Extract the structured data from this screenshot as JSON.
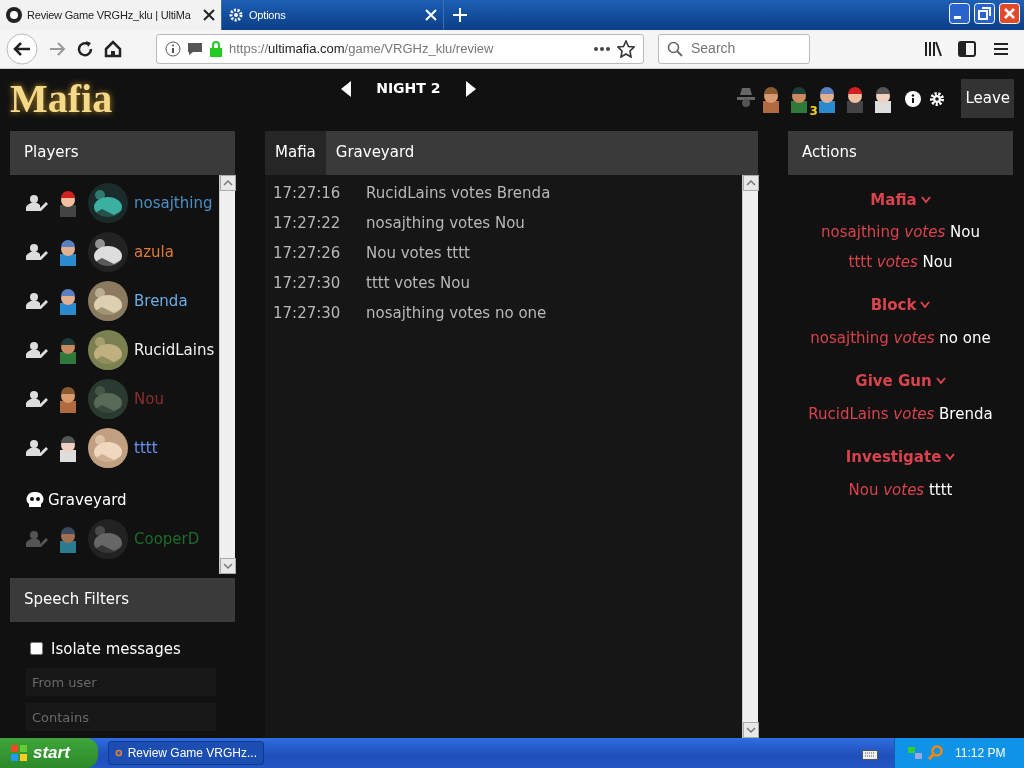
{
  "browser": {
    "tabs": [
      {
        "title": "Review Game VRGHz_klu | UltiMa",
        "selected": true
      },
      {
        "title": "Options",
        "selected": false
      }
    ],
    "url_scheme": "https://",
    "url_host": "ultimafia.com",
    "url_path": "/game/VRGHz_klu/review",
    "search_placeholder": "Search"
  },
  "header": {
    "logo": "Mafia",
    "phase": "NIGHT 2",
    "role_badge": "3",
    "leave_button": "Leave"
  },
  "players_panel": {
    "title": "Players",
    "players": [
      {
        "name": "nosajthing",
        "color": "#4a8fc4"
      },
      {
        "name": "azula",
        "color": "#e07a3a"
      },
      {
        "name": "Brenda",
        "color": "#6aaee6"
      },
      {
        "name": "RucidLains",
        "color": "#f0f0f0"
      },
      {
        "name": "Nou",
        "color": "#8a2e2e"
      },
      {
        "name": "tttt",
        "color": "#6a90f0"
      }
    ],
    "graveyard_title": "Graveyard",
    "dead": [
      {
        "name": "CooperD",
        "color": "#1f6a2c"
      }
    ]
  },
  "speech_filters": {
    "title": "Speech Filters",
    "isolate": {
      "label": "Isolate messages",
      "checked": false
    },
    "fields": [
      {
        "placeholder": "From user"
      },
      {
        "placeholder": "Contains"
      }
    ]
  },
  "chat": {
    "tabs": [
      {
        "label": "Mafia",
        "selected": true
      },
      {
        "label": "Graveyard",
        "selected": false
      }
    ],
    "messages": [
      {
        "time": "17:27:16",
        "text": "RucidLains votes Brenda"
      },
      {
        "time": "17:27:22",
        "text": "nosajthing votes Nou"
      },
      {
        "time": "17:27:26",
        "text": "Nou votes tttt"
      },
      {
        "time": "17:27:30",
        "text": "tttt votes Nou"
      },
      {
        "time": "17:27:30",
        "text": "nosajthing votes no one"
      }
    ]
  },
  "actions": {
    "title": "Actions",
    "groups": [
      {
        "name": "Mafia",
        "votes": [
          {
            "voter": "nosajthing",
            "verb": "votes",
            "target": "Nou"
          },
          {
            "voter": "tttt",
            "verb": "votes",
            "target": "Nou"
          }
        ]
      },
      {
        "name": "Block",
        "votes": [
          {
            "voter": "nosajthing",
            "verb": "votes",
            "target": "no one"
          }
        ]
      },
      {
        "name": "Give Gun",
        "votes": [
          {
            "voter": "RucidLains",
            "verb": "votes",
            "target": "Brenda"
          }
        ]
      },
      {
        "name": "Investigate",
        "votes": [
          {
            "voter": "Nou",
            "verb": "votes",
            "target": "tttt"
          }
        ]
      }
    ]
  },
  "taskbar": {
    "start": "start",
    "task": "Review Game VRGHz...",
    "clock": "11:12 PM"
  }
}
